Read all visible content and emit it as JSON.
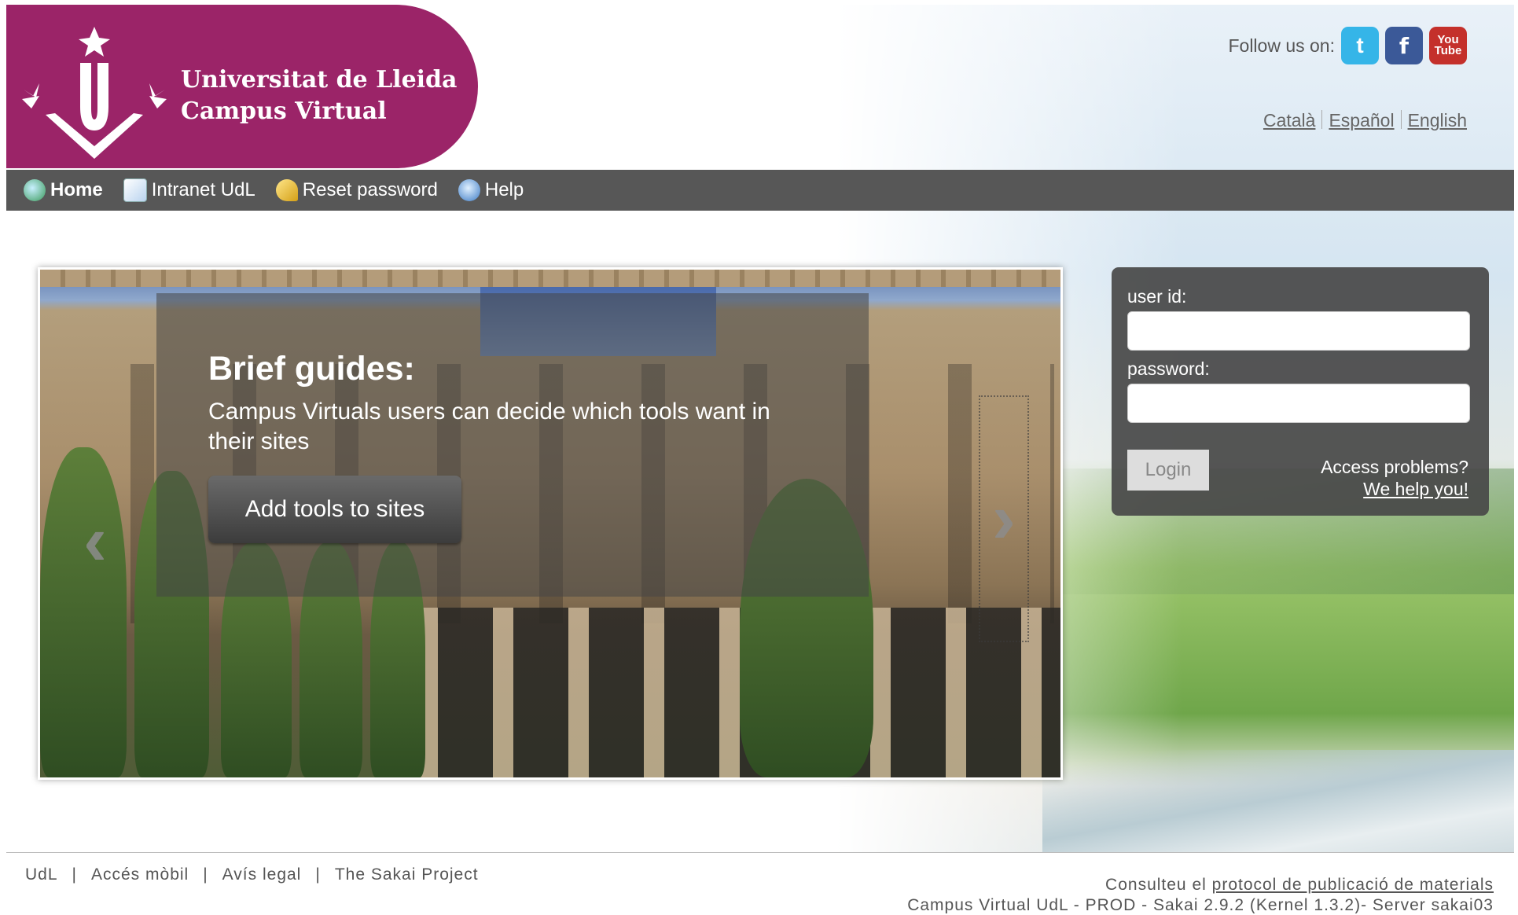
{
  "brand": {
    "line1": "Universitat de Lleida",
    "line2": "Campus Virtual",
    "color": "#9b2468"
  },
  "social": {
    "label": "Follow us on:",
    "icons": [
      "twitter-icon",
      "facebook-icon",
      "youtube-icon"
    ]
  },
  "languages": [
    "Català",
    "Español",
    "English"
  ],
  "nav": [
    {
      "label": "Home",
      "icon": "home-icon",
      "active": true
    },
    {
      "label": "Intranet UdL",
      "icon": "document-icon"
    },
    {
      "label": "Reset password",
      "icon": "key-icon"
    },
    {
      "label": "Help",
      "icon": "help-icon"
    }
  ],
  "slide": {
    "title": "Brief guides:",
    "text": "Campus Virtuals users can decide which tools want in their sites",
    "button": "Add tools to sites",
    "prev": "‹",
    "next": "›"
  },
  "login": {
    "userid_label": "user id:",
    "password_label": "password:",
    "userid_value": "",
    "password_value": "",
    "button": "Login",
    "problems": "Access problems?",
    "help_link": "We help you!"
  },
  "footer": {
    "links": [
      "UdL",
      "Accés mòbil",
      "Avís legal",
      "The Sakai Project"
    ],
    "consult_prefix": "Consulteu el",
    "consult_link": "protocol de publicació de materials",
    "server_info": "Campus Virtual UdL - PROD - Sakai 2.9.2 (Kernel 1.3.2)- Server sakai03"
  }
}
